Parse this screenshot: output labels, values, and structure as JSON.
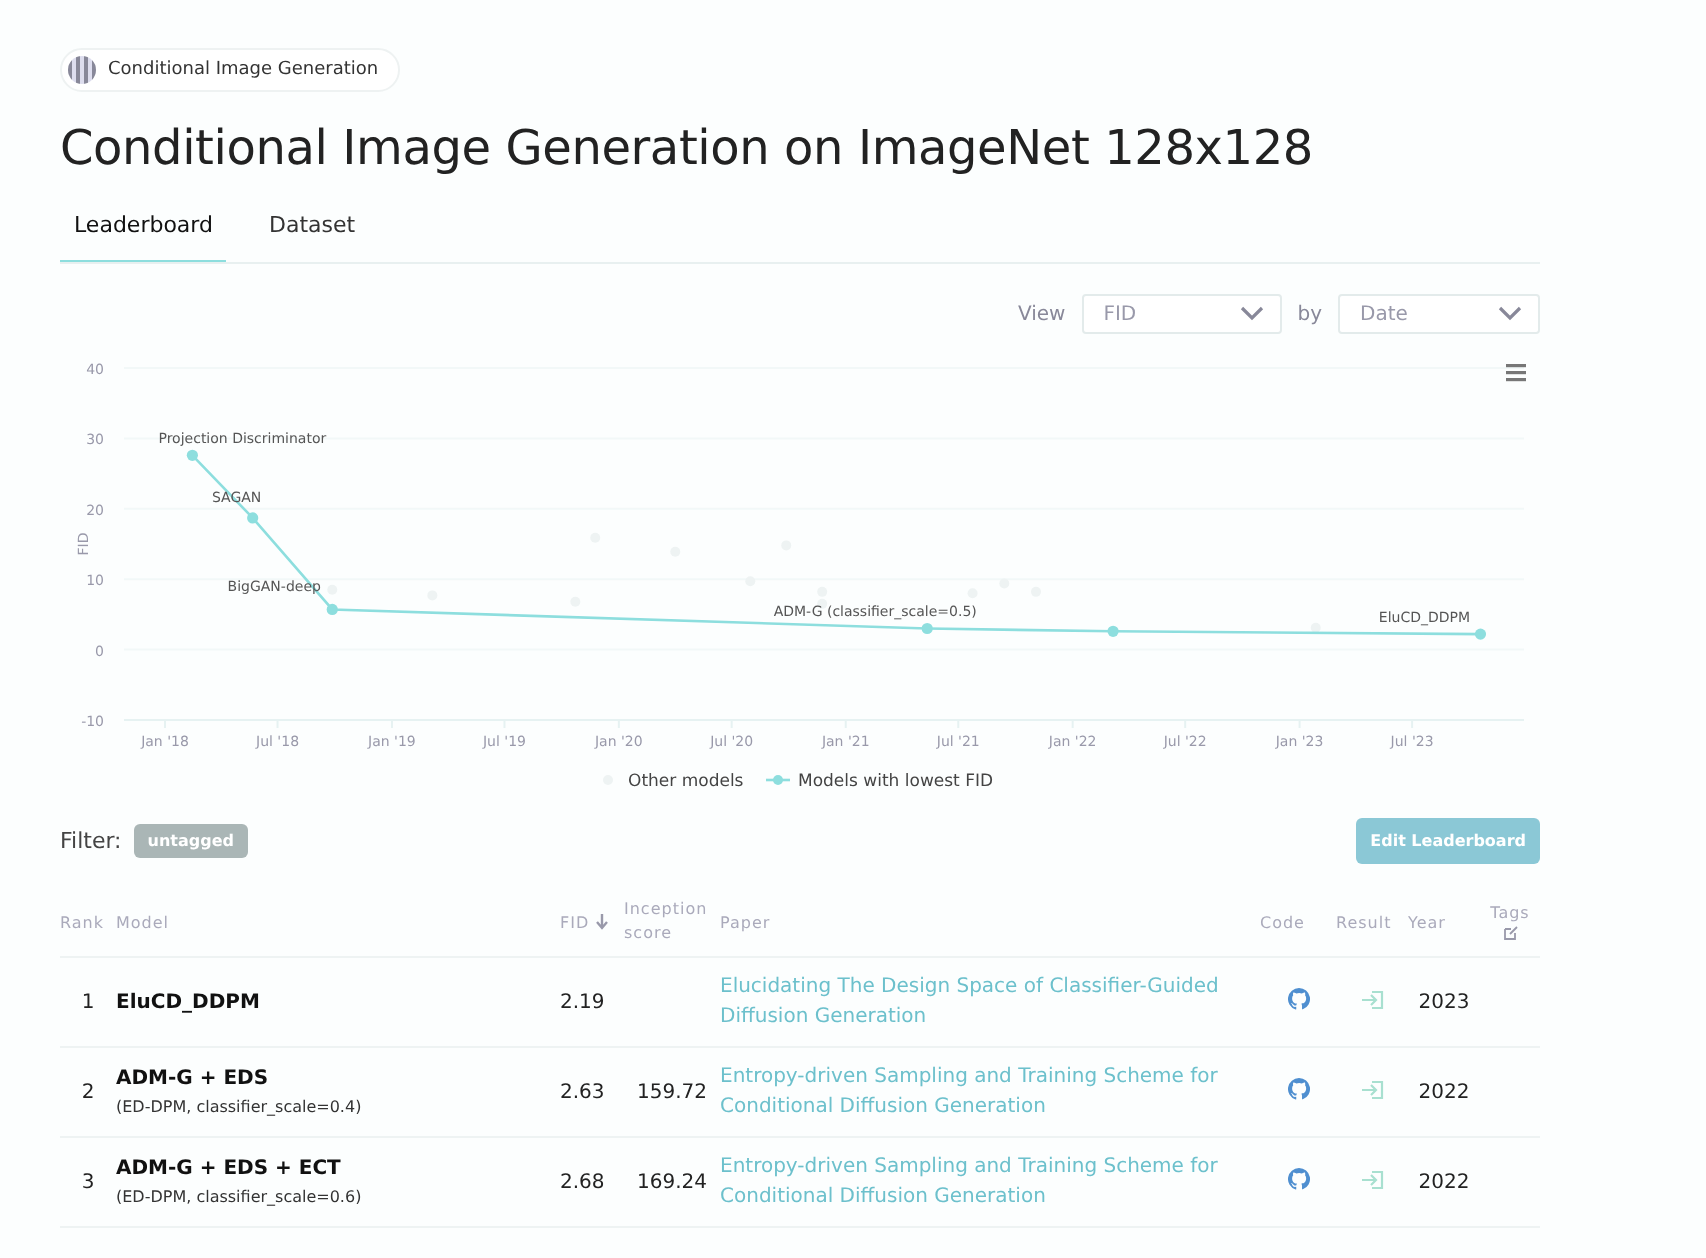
{
  "breadcrumb": {
    "label": "Conditional Image Generation"
  },
  "title": "Conditional Image Generation on ImageNet 128x128",
  "tabs": [
    {
      "label": "Leaderboard",
      "selected": true
    },
    {
      "label": "Dataset",
      "selected": false
    }
  ],
  "view_controls": [
    {
      "label": "View",
      "value": "FID"
    },
    {
      "label": "by",
      "value": "Date"
    }
  ],
  "chart": {
    "chart_data": {
      "type": "line",
      "ylabel": "FID",
      "xlim": [
        "2017-10-27",
        "2023-12-28"
      ],
      "ylim": [
        -10,
        40
      ],
      "yticks": [
        -10,
        0,
        10,
        20,
        30,
        40
      ],
      "xticks": [
        {
          "value": "2018-01-01",
          "label": "Jan '18"
        },
        {
          "value": "2018-07-01",
          "label": "Jul '18"
        },
        {
          "value": "2019-01-01",
          "label": "Jan '19"
        },
        {
          "value": "2019-07-01",
          "label": "Jul '19"
        },
        {
          "value": "2020-01-01",
          "label": "Jan '20"
        },
        {
          "value": "2020-07-01",
          "label": "Jul '20"
        },
        {
          "value": "2021-01-01",
          "label": "Jan '21"
        },
        {
          "value": "2021-07-01",
          "label": "Jul '21"
        },
        {
          "value": "2022-01-01",
          "label": "Jan '22"
        },
        {
          "value": "2022-07-01",
          "label": "Jul '22"
        },
        {
          "value": "2023-01-01",
          "label": "Jan '23"
        },
        {
          "value": "2023-07-01",
          "label": "Jul '23"
        }
      ],
      "series": [
        {
          "name": "Other models",
          "type": "scatter",
          "color": "#eef3f3",
          "x": [
            "2018-09-27",
            "2019-03-07",
            "2019-10-23",
            "2019-11-24",
            "2020-04-01",
            "2020-07-31",
            "2020-09-27",
            "2020-11-24",
            "2020-11-24",
            "2021-07-24",
            "2021-09-13",
            "2021-11-03",
            "2023-01-27"
          ],
          "values": [
            8.5,
            7.7,
            6.8,
            15.9,
            13.9,
            9.7,
            14.8,
            8.2,
            6.5,
            8.0,
            9.4,
            8.2,
            3.1
          ]
        },
        {
          "name": "Models with lowest FID",
          "type": "line",
          "marker": "circle",
          "color": "#8ddede",
          "x": [
            "2018-02-14",
            "2018-05-22",
            "2018-09-27",
            "2021-05-12",
            "2022-03-07",
            "2023-10-19"
          ],
          "values": [
            27.6,
            18.7,
            5.7,
            3.0,
            2.6,
            2.2
          ]
        }
      ],
      "grid": true,
      "legend": true,
      "annotations": [
        {
          "x": "2018-02-14",
          "y": 27.6,
          "text": "Projection Discriminator"
        },
        {
          "x": "2018-05-22",
          "y": 18.7,
          "text": "SAGAN"
        },
        {
          "x": "2018-09-27",
          "y": 5.7,
          "text": "BigGAN-deep"
        },
        {
          "x": "2021-05-12",
          "y": 3.0,
          "text": "ADM-G (classifier_scale=0.5)"
        },
        {
          "x": "2023-10-19",
          "y": 2.2,
          "text": "EluCD_DDPM"
        }
      ]
    }
  },
  "filter": {
    "label": "Filter:",
    "tag": "untagged"
  },
  "edit_button": "Edit Leaderboard",
  "table": {
    "columns": [
      "Rank",
      "Model",
      "FID",
      "Inception score",
      "Paper",
      "Code",
      "Result",
      "Year",
      "Tags"
    ],
    "rows": [
      {
        "rank": "1",
        "model": "EluCD_DDPM",
        "model_detail": "",
        "fid": "2.19",
        "inception_score": "",
        "paper": "Elucidating The Design Space of Classifier-Guided Diffusion Generation",
        "year": "2023"
      },
      {
        "rank": "2",
        "model": "ADM-G + EDS",
        "model_detail": "(ED-DPM, classifier_scale=0.4)",
        "fid": "2.63",
        "inception_score": "159.72",
        "paper": "Entropy-driven Sampling and Training Scheme for Conditional Diffusion Generation",
        "year": "2022"
      },
      {
        "rank": "3",
        "model": "ADM-G + EDS + ECT",
        "model_detail": "(ED-DPM, classifier_scale=0.6)",
        "fid": "2.68",
        "inception_score": "169.24",
        "paper": "Entropy-driven Sampling and Training Scheme for Conditional Diffusion Generation",
        "year": "2022"
      }
    ]
  }
}
